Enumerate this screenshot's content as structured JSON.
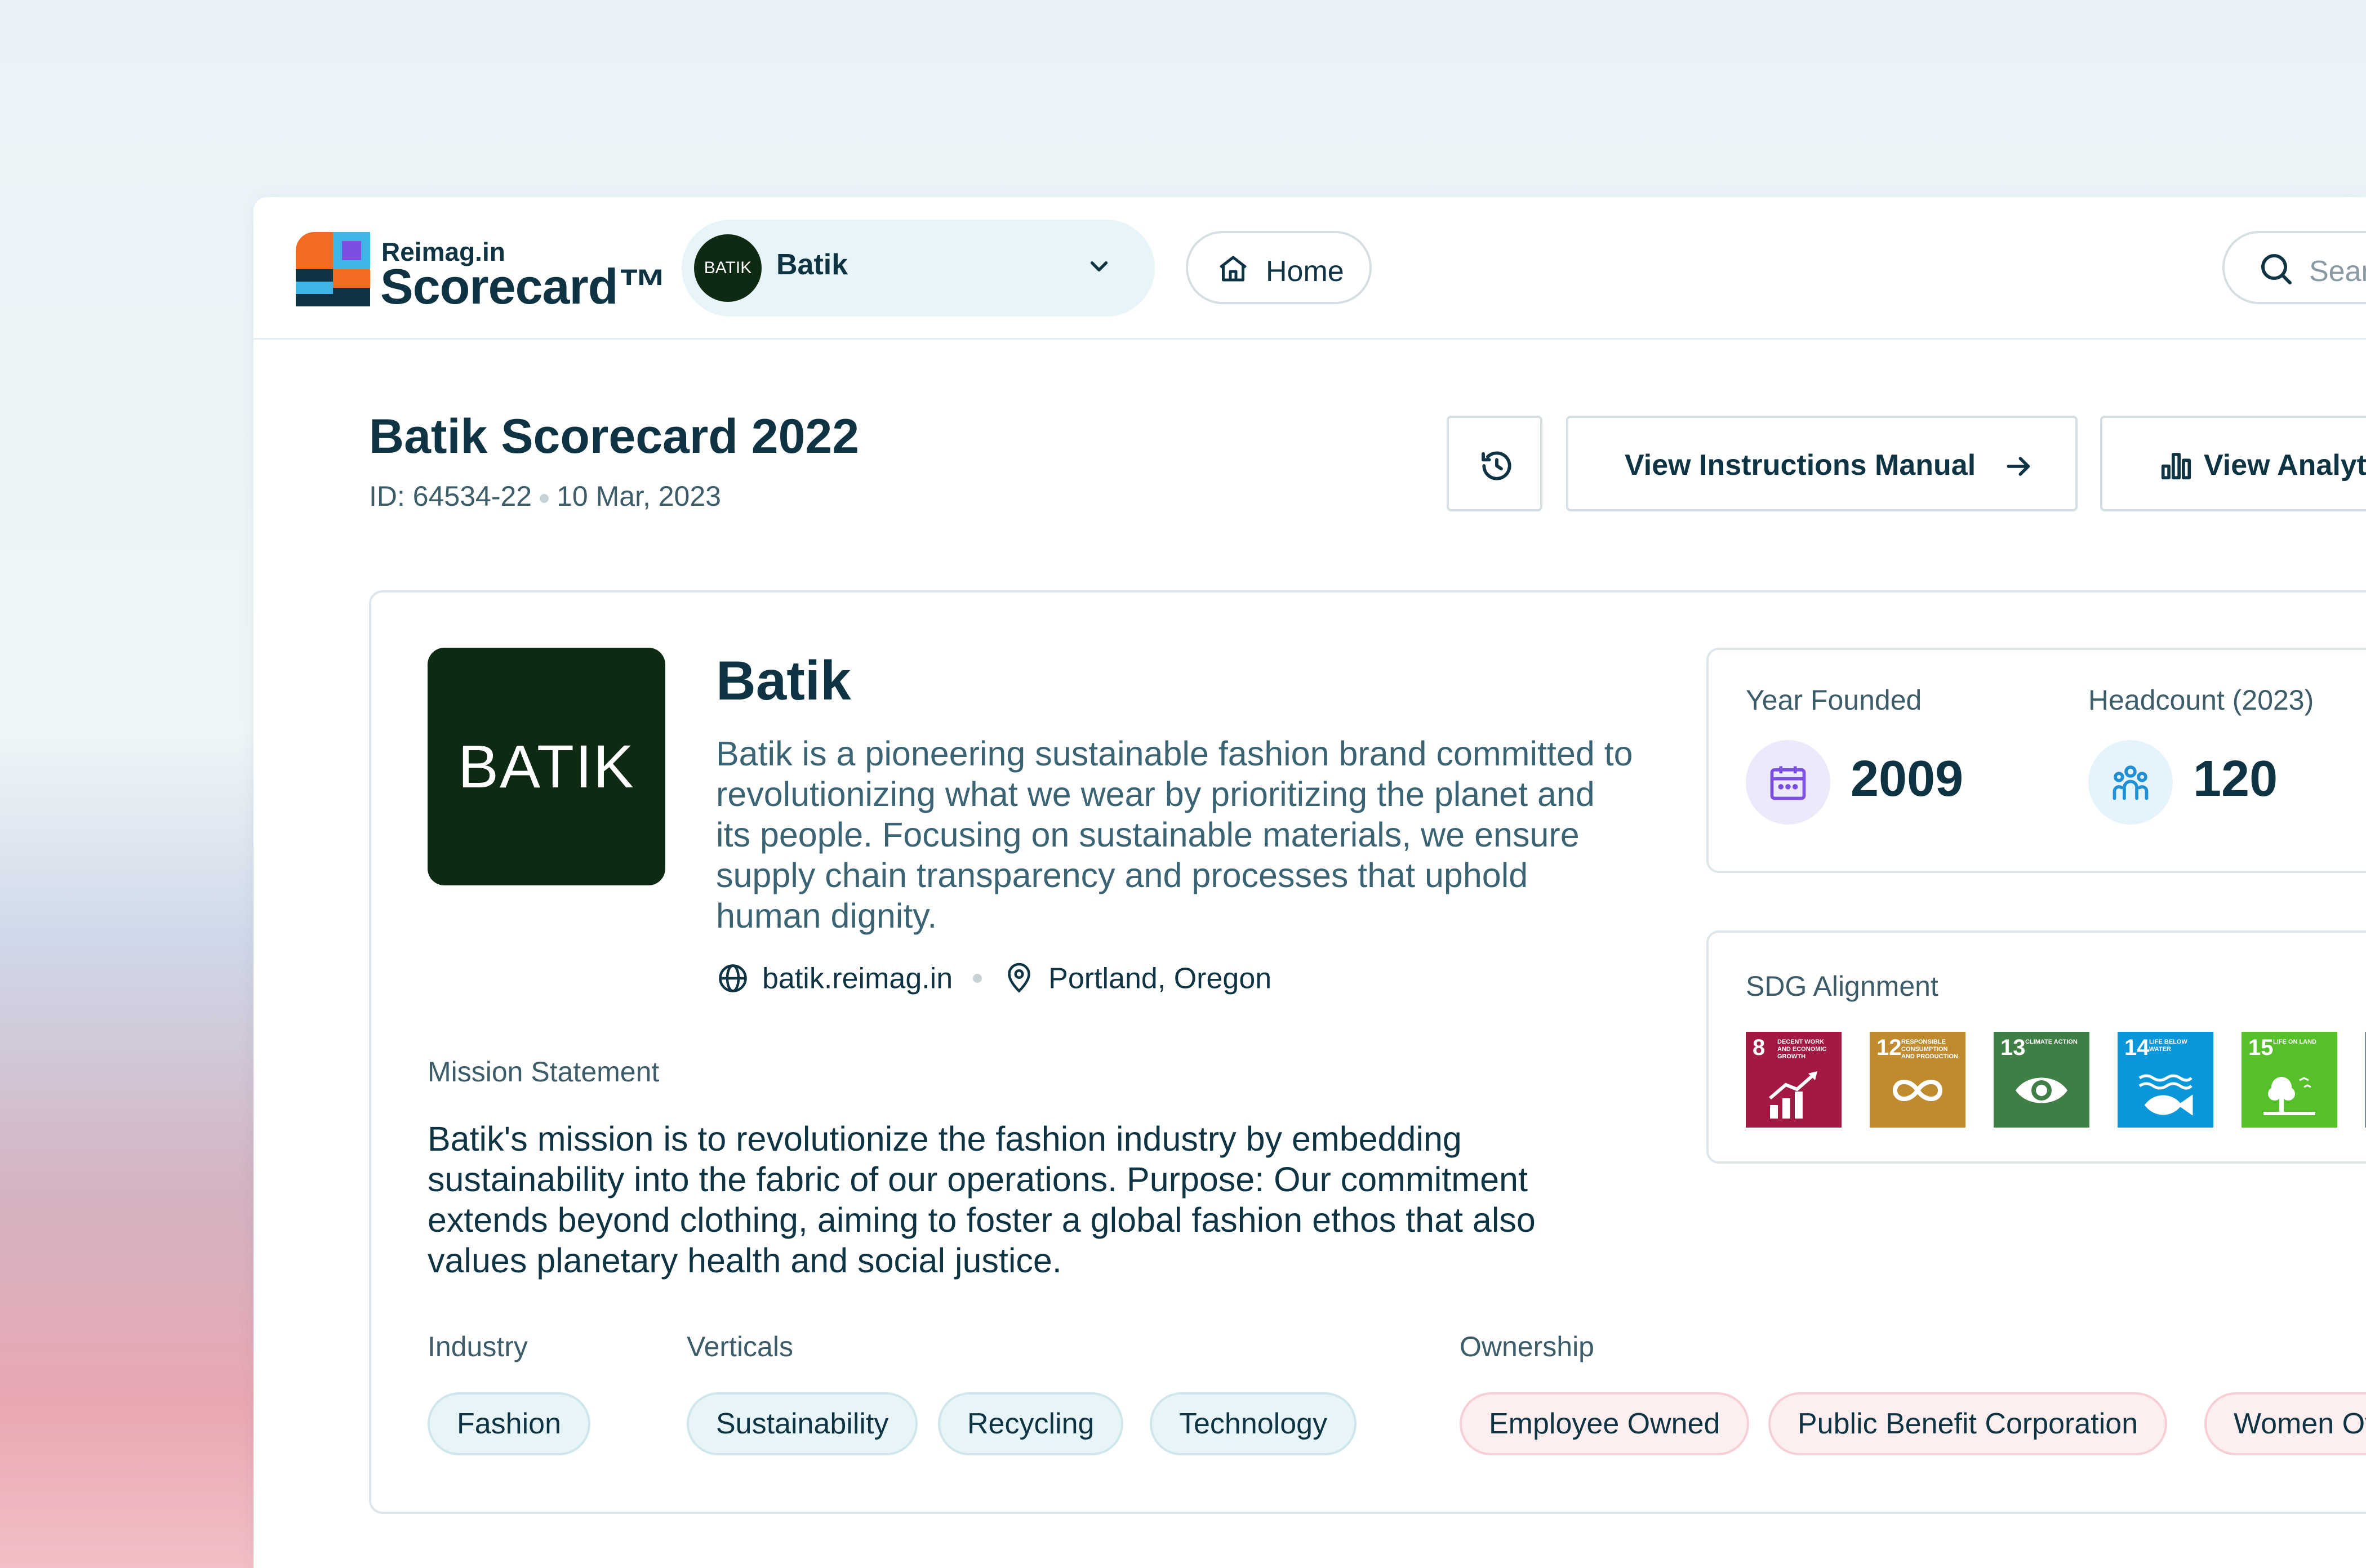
{
  "brand": {
    "small": "Reimag.in",
    "big": "Scorecard™"
  },
  "company_select": {
    "avatar_text": "BATIK",
    "name": "Batik"
  },
  "nav": {
    "home_label": "Home"
  },
  "search": {
    "placeholder": "Sear"
  },
  "page": {
    "title": "Batik Scorecard 2022",
    "id": "ID: 64534-22",
    "date": "10 Mar, 2023"
  },
  "actions": {
    "manual_label": "View Instructions Manual",
    "analytics_label": "View Analyt"
  },
  "company": {
    "logo_text": "BATIK",
    "name": "Batik",
    "description": "Batik is a pioneering sustainable fashion brand committed to revolutionizing what we wear by prioritizing the planet and its people. Focusing on sustainable materials, we ensure supply chain transparency and processes that uphold human dignity.",
    "website": "batik.reimag.in",
    "location": "Portland, Oregon"
  },
  "mission": {
    "label": "Mission Statement",
    "text": "Batik's mission is to revolutionize the fashion industry by embedding sustainability into the fabric of our operations. Purpose: Our commitment extends beyond clothing, aiming to foster a global fashion ethos that also values planetary health and social justice."
  },
  "industry": {
    "label": "Industry",
    "chips": [
      "Fashion"
    ]
  },
  "verticals": {
    "label": "Verticals",
    "chips": [
      "Sustainability",
      "Recycling",
      "Technology"
    ]
  },
  "ownership": {
    "label": "Ownership",
    "chips": [
      "Employee Owned",
      "Public Benefit Corporation",
      "Women Ov"
    ]
  },
  "stats": {
    "year_label": "Year Founded",
    "year_value": "2009",
    "headcount_label": "Headcount (2023)",
    "headcount_value": "120"
  },
  "sdg": {
    "label": "SDG Alignment",
    "goals": [
      {
        "num": "8",
        "text": "Decent work and economic growth",
        "color": "#a21942",
        "icon": "growth-chart-icon"
      },
      {
        "num": "12",
        "text": "Responsible consumption and production",
        "color": "#bf8b2e",
        "icon": "infinity-icon"
      },
      {
        "num": "13",
        "text": "Climate action",
        "color": "#3f7e44",
        "icon": "eye-globe-icon"
      },
      {
        "num": "14",
        "text": "Life below water",
        "color": "#0a97d9",
        "icon": "fish-icon"
      },
      {
        "num": "15",
        "text": "Life on land",
        "color": "#56c02b",
        "icon": "tree-icon"
      }
    ]
  },
  "colors": {
    "primary_text": "#0e3443",
    "teal_chip": "#e8f5f8",
    "pink_chip": "#fdeff0",
    "year_circle": "#ece9fb",
    "headcount_circle": "#e5f3fb"
  }
}
